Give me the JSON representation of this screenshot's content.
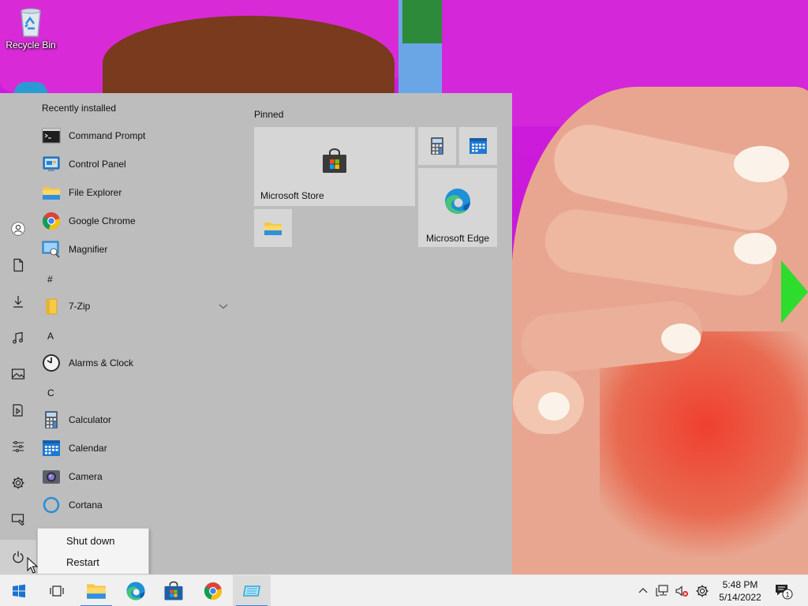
{
  "desktop": {
    "icons": [
      {
        "label": "Recycle Bin",
        "icon": "recycle-bin-icon"
      }
    ]
  },
  "start_menu": {
    "section_recent": "Recently installed",
    "recent_apps": [
      {
        "label": "Command Prompt",
        "icon": "command-prompt-icon"
      },
      {
        "label": "Control Panel",
        "icon": "control-panel-icon"
      },
      {
        "label": "File Explorer",
        "icon": "file-explorer-icon"
      },
      {
        "label": "Google Chrome",
        "icon": "chrome-icon"
      },
      {
        "label": "Magnifier",
        "icon": "magnifier-icon"
      }
    ],
    "groups": [
      {
        "letter": "#",
        "apps": [
          {
            "label": "7-Zip",
            "icon": "folder-icon",
            "expandable": true
          }
        ]
      },
      {
        "letter": "A",
        "apps": [
          {
            "label": "Alarms & Clock",
            "icon": "alarm-clock-icon"
          }
        ]
      },
      {
        "letter": "C",
        "apps": [
          {
            "label": "Calculator",
            "icon": "calculator-icon"
          },
          {
            "label": "Calendar",
            "icon": "calendar-icon"
          },
          {
            "label": "Camera",
            "icon": "camera-icon"
          },
          {
            "label": "Cortana",
            "icon": "cortana-icon"
          }
        ]
      }
    ],
    "rail": [
      "user-icon",
      "documents-icon",
      "downloads-icon",
      "music-icon",
      "pictures-icon",
      "videos-icon",
      "network-icon",
      "settings-icon",
      "personalization-icon",
      "power-icon"
    ],
    "pinned_header": "Pinned",
    "tiles": [
      {
        "label": "Microsoft Store",
        "icon": "store-icon"
      },
      {
        "label": "",
        "icon": "calculator-icon"
      },
      {
        "label": "",
        "icon": "calendar-icon"
      },
      {
        "label": "",
        "icon": "file-explorer-icon"
      },
      {
        "label": "Microsoft Edge",
        "icon": "edge-icon"
      }
    ],
    "power_menu": [
      "Shut down",
      "Restart"
    ]
  },
  "taskbar": {
    "buttons": [
      "start-icon",
      "task-view-icon",
      "file-explorer-icon",
      "edge-icon",
      "store-icon",
      "chrome-icon",
      "app-icon"
    ],
    "tray_icons": [
      "chevron-up-icon",
      "network-icon",
      "volume-muted-icon",
      "settings-icon"
    ],
    "time": "5:48 PM",
    "date": "5/14/2022",
    "notifications": "1"
  },
  "colors": {
    "start_bg": "#bdbdbd",
    "tile_bg": "#d6d6d6",
    "taskbar_bg": "#f0f0f0",
    "accent": "#3c7fd6"
  }
}
